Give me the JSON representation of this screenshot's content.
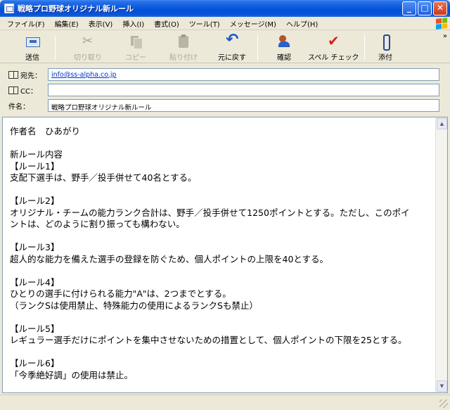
{
  "window": {
    "title": "戦略プロ野球オリジナル新ルール",
    "minimize": "_",
    "maximize": "□",
    "close": "✕"
  },
  "menu": {
    "items": [
      "ファイル(F)",
      "編集(E)",
      "表示(V)",
      "挿入(I)",
      "書式(O)",
      "ツール(T)",
      "メッセージ(M)",
      "ヘルプ(H)"
    ]
  },
  "toolbar": {
    "send": "送信",
    "cut": "切り取り",
    "copy": "コピー",
    "paste": "貼り付け",
    "undo": "元に戻す",
    "check": "確認",
    "spell": "スペル チェック",
    "attach": "添付",
    "more": "»"
  },
  "fields": {
    "to_label": "宛先：",
    "to_value": "info@ss-alpha.co.jp",
    "cc_label": "CC：",
    "cc_value": "",
    "subject_label": "件名：",
    "subject_value": "戦略プロ野球オリジナル新ルール"
  },
  "body": {
    "lines": [
      "作者名　ひあがり",
      "",
      "新ルール内容",
      "【ルール1】",
      "支配下選手は、野手／投手併せて40名とする。",
      "",
      "【ルール2】",
      "オリジナル・チームの能力ランク合計は、野手／投手併せて1250ポイントとする。ただし、このポイ",
      "ントは、どのように割り振っても構わない。",
      "",
      "【ルール3】",
      "超人的な能力を備えた選手の登録を防ぐため、個人ポイントの上限を40とする。",
      "",
      "【ルール4】",
      "ひとりの選手に付けられる能力\"A\"は、2つまでとする。",
      "（ランクSは使用禁止、特殊能力の使用によるランクSも禁止）",
      "",
      "【ルール5】",
      "レギュラー選手だけにポイントを集中させないための措置として、個人ポイントの下限を25とする。",
      "",
      "【ルール6】",
      "「今季絶好調」の使用は禁止。"
    ]
  },
  "scrollbar": {
    "up": "▲",
    "down": "▼"
  }
}
